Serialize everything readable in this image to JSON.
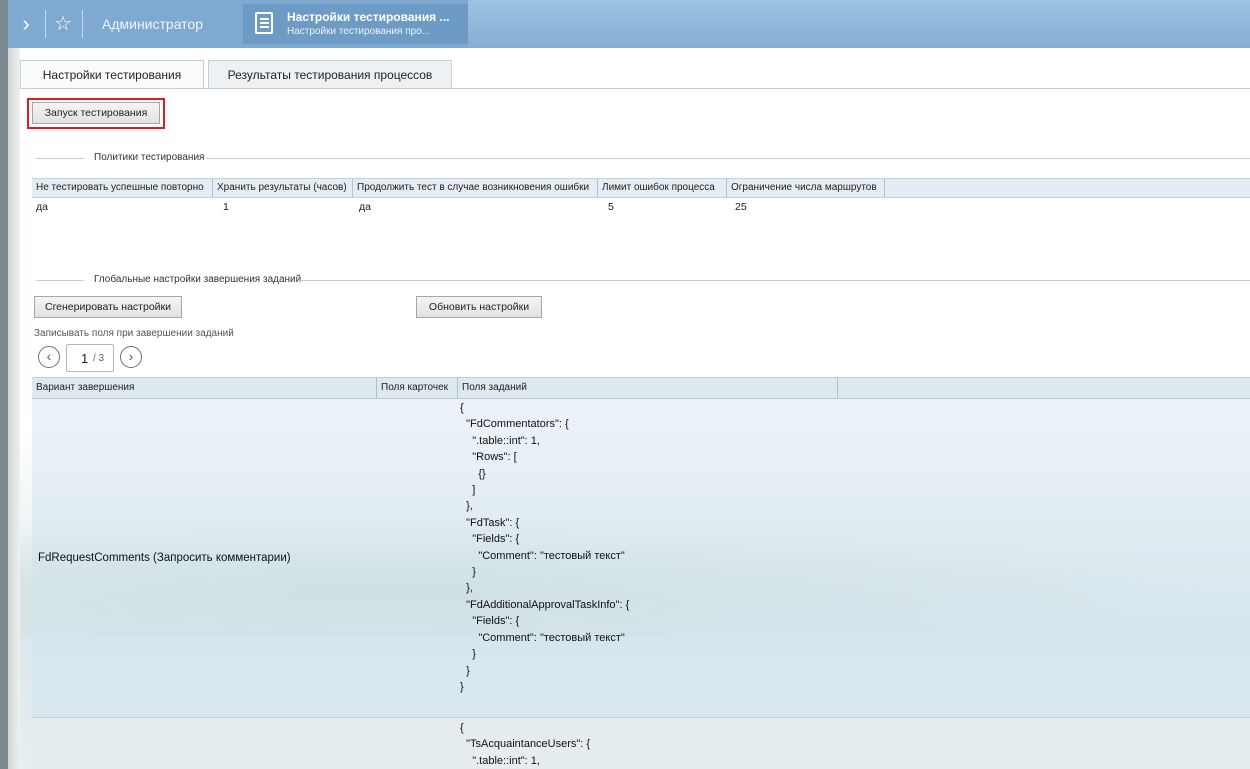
{
  "window": {
    "admin_tab": "Администратор",
    "active_tab_title": "Настройки тестирования ...",
    "active_tab_subtitle": "Настройки тестирования про..."
  },
  "icons": {
    "expand": "chevron-right-icon",
    "favorite": "star-icon",
    "document": "document-icon"
  },
  "tabs": [
    {
      "label": "Настройки тестирования",
      "active": true
    },
    {
      "label": "Результаты тестирования процессов",
      "active": false
    }
  ],
  "run_button": "Запуск тестирования",
  "policies": {
    "legend": "Политики тестирования",
    "columns": [
      "Не тестировать успешные повторно",
      "Хранить результаты (часов)",
      "Продолжить тест в случае возникновения ошибки",
      "Лимит ошибок процесса",
      "Ограничение числа маршрутов"
    ],
    "row": [
      "да",
      "1",
      "да",
      "5",
      "25"
    ]
  },
  "global": {
    "legend": "Глобальные настройки завершения заданий",
    "generate_button": "Сгенерировать настройки",
    "update_button": "Обновить настройки",
    "fields_label": "Записывать поля при завершении заданий",
    "pager": {
      "current": "1",
      "total": "/ 3",
      "prev": "chevron-left-icon",
      "next": "chevron-right-icon"
    },
    "columns": [
      "Вариант завершения",
      "Поля карточек",
      "Поля заданий"
    ],
    "rows": [
      {
        "variant": "FdRequestComments (Запросить комментарии)",
        "task_fields": "{\n  \"FdCommentators\": {\n    \".table::int\": 1,\n    \"Rows\": [\n      {}\n    ]\n  },\n  \"FdTask\": {\n    \"Fields\": {\n      \"Comment\": \"тестовый текст\"\n    }\n  },\n  \"FdAdditionalApprovalTaskInfo\": {\n    \"Fields\": {\n      \"Comment\": \"тестовый текст\"\n    }\n  }\n}"
      },
      {
        "variant": "",
        "task_fields": "{\n  \"TsAcquaintanceUsers\": {\n    \".table::int\": 1,"
      }
    ]
  }
}
